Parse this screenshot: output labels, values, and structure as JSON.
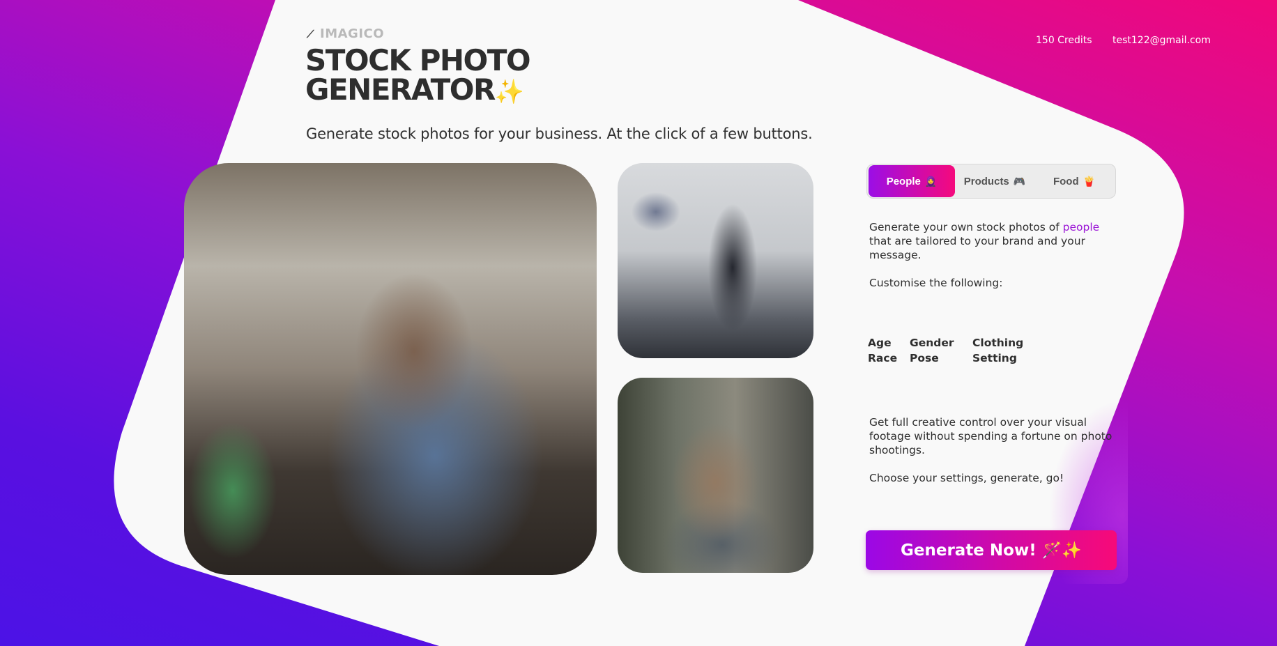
{
  "brand": {
    "name": "IMAGICO",
    "icon": "magic-wand-icon"
  },
  "hero": {
    "title_line1": "STOCK PHOTO",
    "title_line2": "GENERATOR",
    "title_emoji": "✨",
    "subtitle": "Generate stock photos for your business. At the click of a few buttons."
  },
  "header": {
    "credits": "150 Credits",
    "email": "test122@gmail.com"
  },
  "tabs": [
    {
      "label": "People",
      "emoji": "🧕",
      "active": true
    },
    {
      "label": "Products",
      "emoji": "🎮",
      "active": false
    },
    {
      "label": "Food",
      "emoji": "🍟",
      "active": false
    }
  ],
  "panel": {
    "intro_prefix": "Generate your own stock photos of ",
    "intro_highlight": "people",
    "intro_suffix": " that are tailored to your brand and your message.",
    "customise": "Customise the following:",
    "attributes": [
      "Age",
      "Gender",
      "Clothing",
      "Race",
      "Pose",
      "Setting"
    ],
    "control": "Get full creative control over your visual footage without spending a fortune on photo shootings.",
    "cta_text": "Choose your settings, generate, go!"
  },
  "generate_button": {
    "label": "Generate Now!",
    "emoji": "🪄✨"
  },
  "colors": {
    "accent_purple": "#9b08e6",
    "accent_pink": "#f70a78",
    "highlight": "#9b16d6",
    "background_white": "#f9f9f9"
  }
}
